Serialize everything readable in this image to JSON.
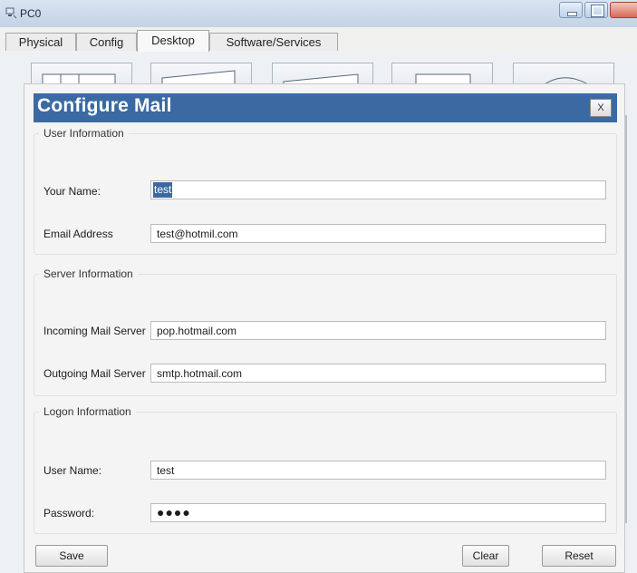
{
  "window": {
    "title": "PC0"
  },
  "tabs": [
    {
      "label": "Physical"
    },
    {
      "label": "Config"
    },
    {
      "label": "Desktop"
    },
    {
      "label": "Software/Services"
    }
  ],
  "active_tab": "Desktop",
  "dialog": {
    "title": "Configure Mail",
    "close_label": "X",
    "user_info": {
      "legend": "User Information",
      "name_label": "Your Name:",
      "name_value": "test",
      "email_label": "Email Address",
      "email_value": "test@hotmil.com"
    },
    "server_info": {
      "legend": "Server Information",
      "incoming_label": "Incoming Mail Server",
      "incoming_value": "pop.hotmail.com",
      "outgoing_label": "Outgoing Mail Server",
      "outgoing_value": "smtp.hotmail.com"
    },
    "logon_info": {
      "legend": "Logon Information",
      "username_label": "User Name:",
      "username_value": "test",
      "password_label": "Password:",
      "password_masked": "●●●●"
    },
    "buttons": {
      "save": "Save",
      "clear": "Clear",
      "reset": "Reset"
    }
  },
  "colors": {
    "dialog_header": "#3b6aa3",
    "titlebar": "#c3d2e6",
    "selection": "#3b6aa3"
  },
  "icons": [
    "app-icon",
    "minimize-icon",
    "maximize-icon",
    "close-icon"
  ]
}
